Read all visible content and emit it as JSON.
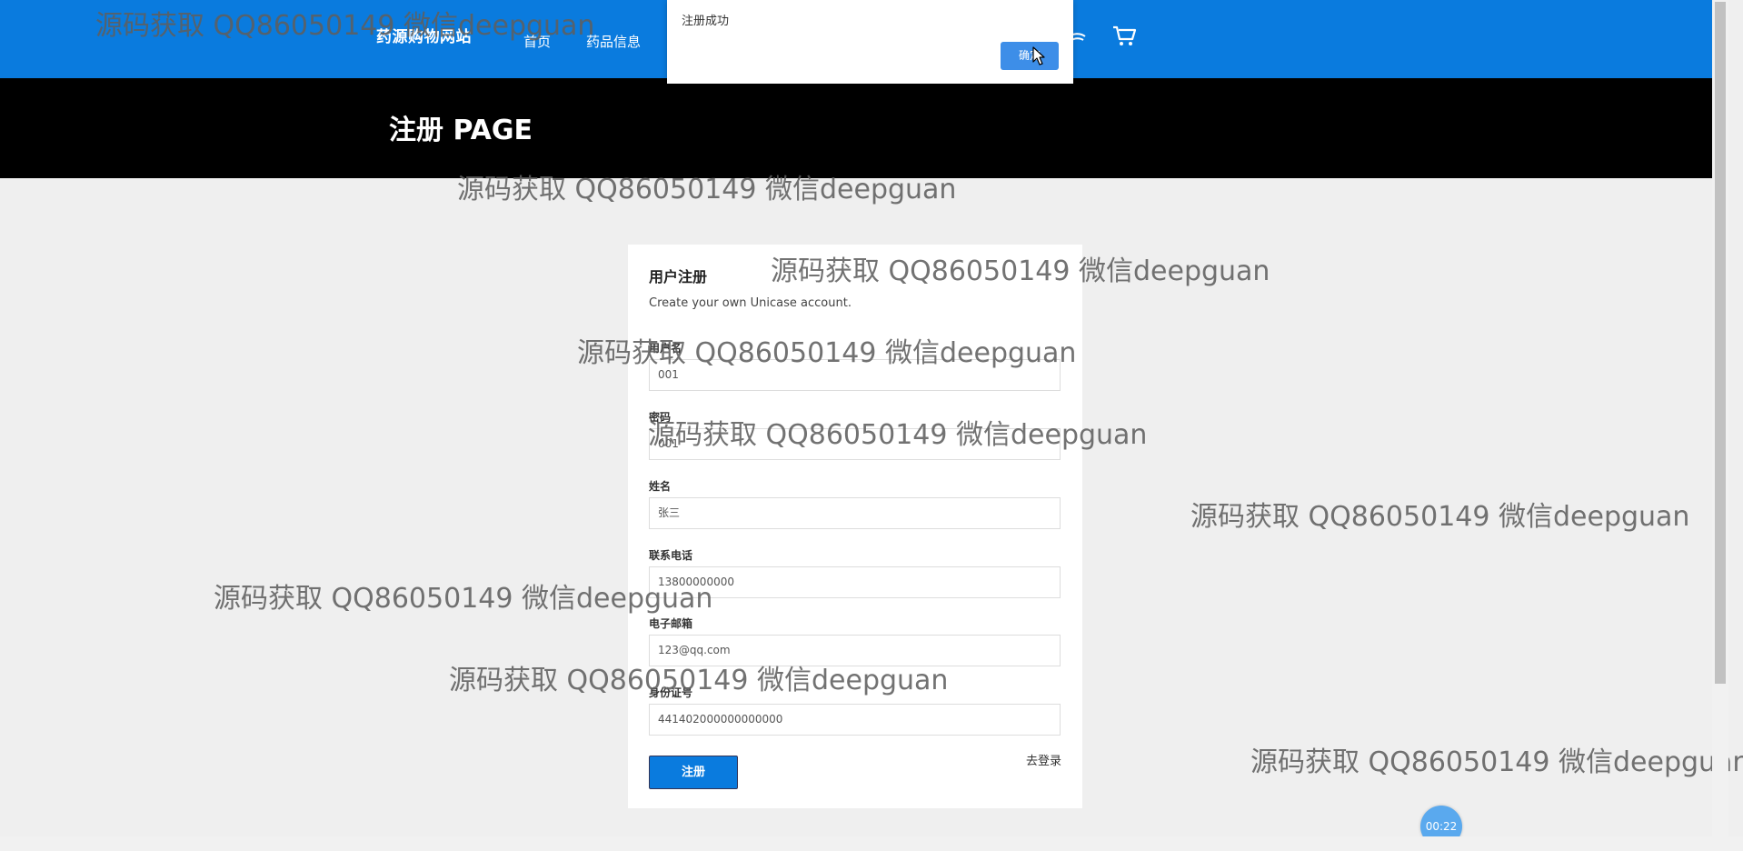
{
  "header": {
    "brand": "药源购物网站",
    "nav": [
      "首页",
      "药品信息"
    ],
    "bg_color": "#0a7bde"
  },
  "banner": {
    "title": "注册 PAGE"
  },
  "form": {
    "title": "用户注册",
    "subtitle": "Create your own Unicase account.",
    "fields": [
      {
        "label": "用户名",
        "value": "001"
      },
      {
        "label": "密码",
        "value": "001"
      },
      {
        "label": "姓名",
        "value": "张三"
      },
      {
        "label": "联系电话",
        "value": "13800000000"
      },
      {
        "label": "电子邮箱",
        "value": "123@qq.com"
      },
      {
        "label": "身份证号",
        "value": "441402000000000000"
      }
    ],
    "submit_label": "注册",
    "login_link": "去登录",
    "accent_color": "#0a7bde"
  },
  "dialog": {
    "message": "注册成功",
    "ok_label": "确定"
  },
  "timer": "00:22",
  "watermark_text": "源码获取 QQ86050149 微信deepguan",
  "icons": [
    "user-icon",
    "cart-icon",
    "cursor-icon"
  ]
}
